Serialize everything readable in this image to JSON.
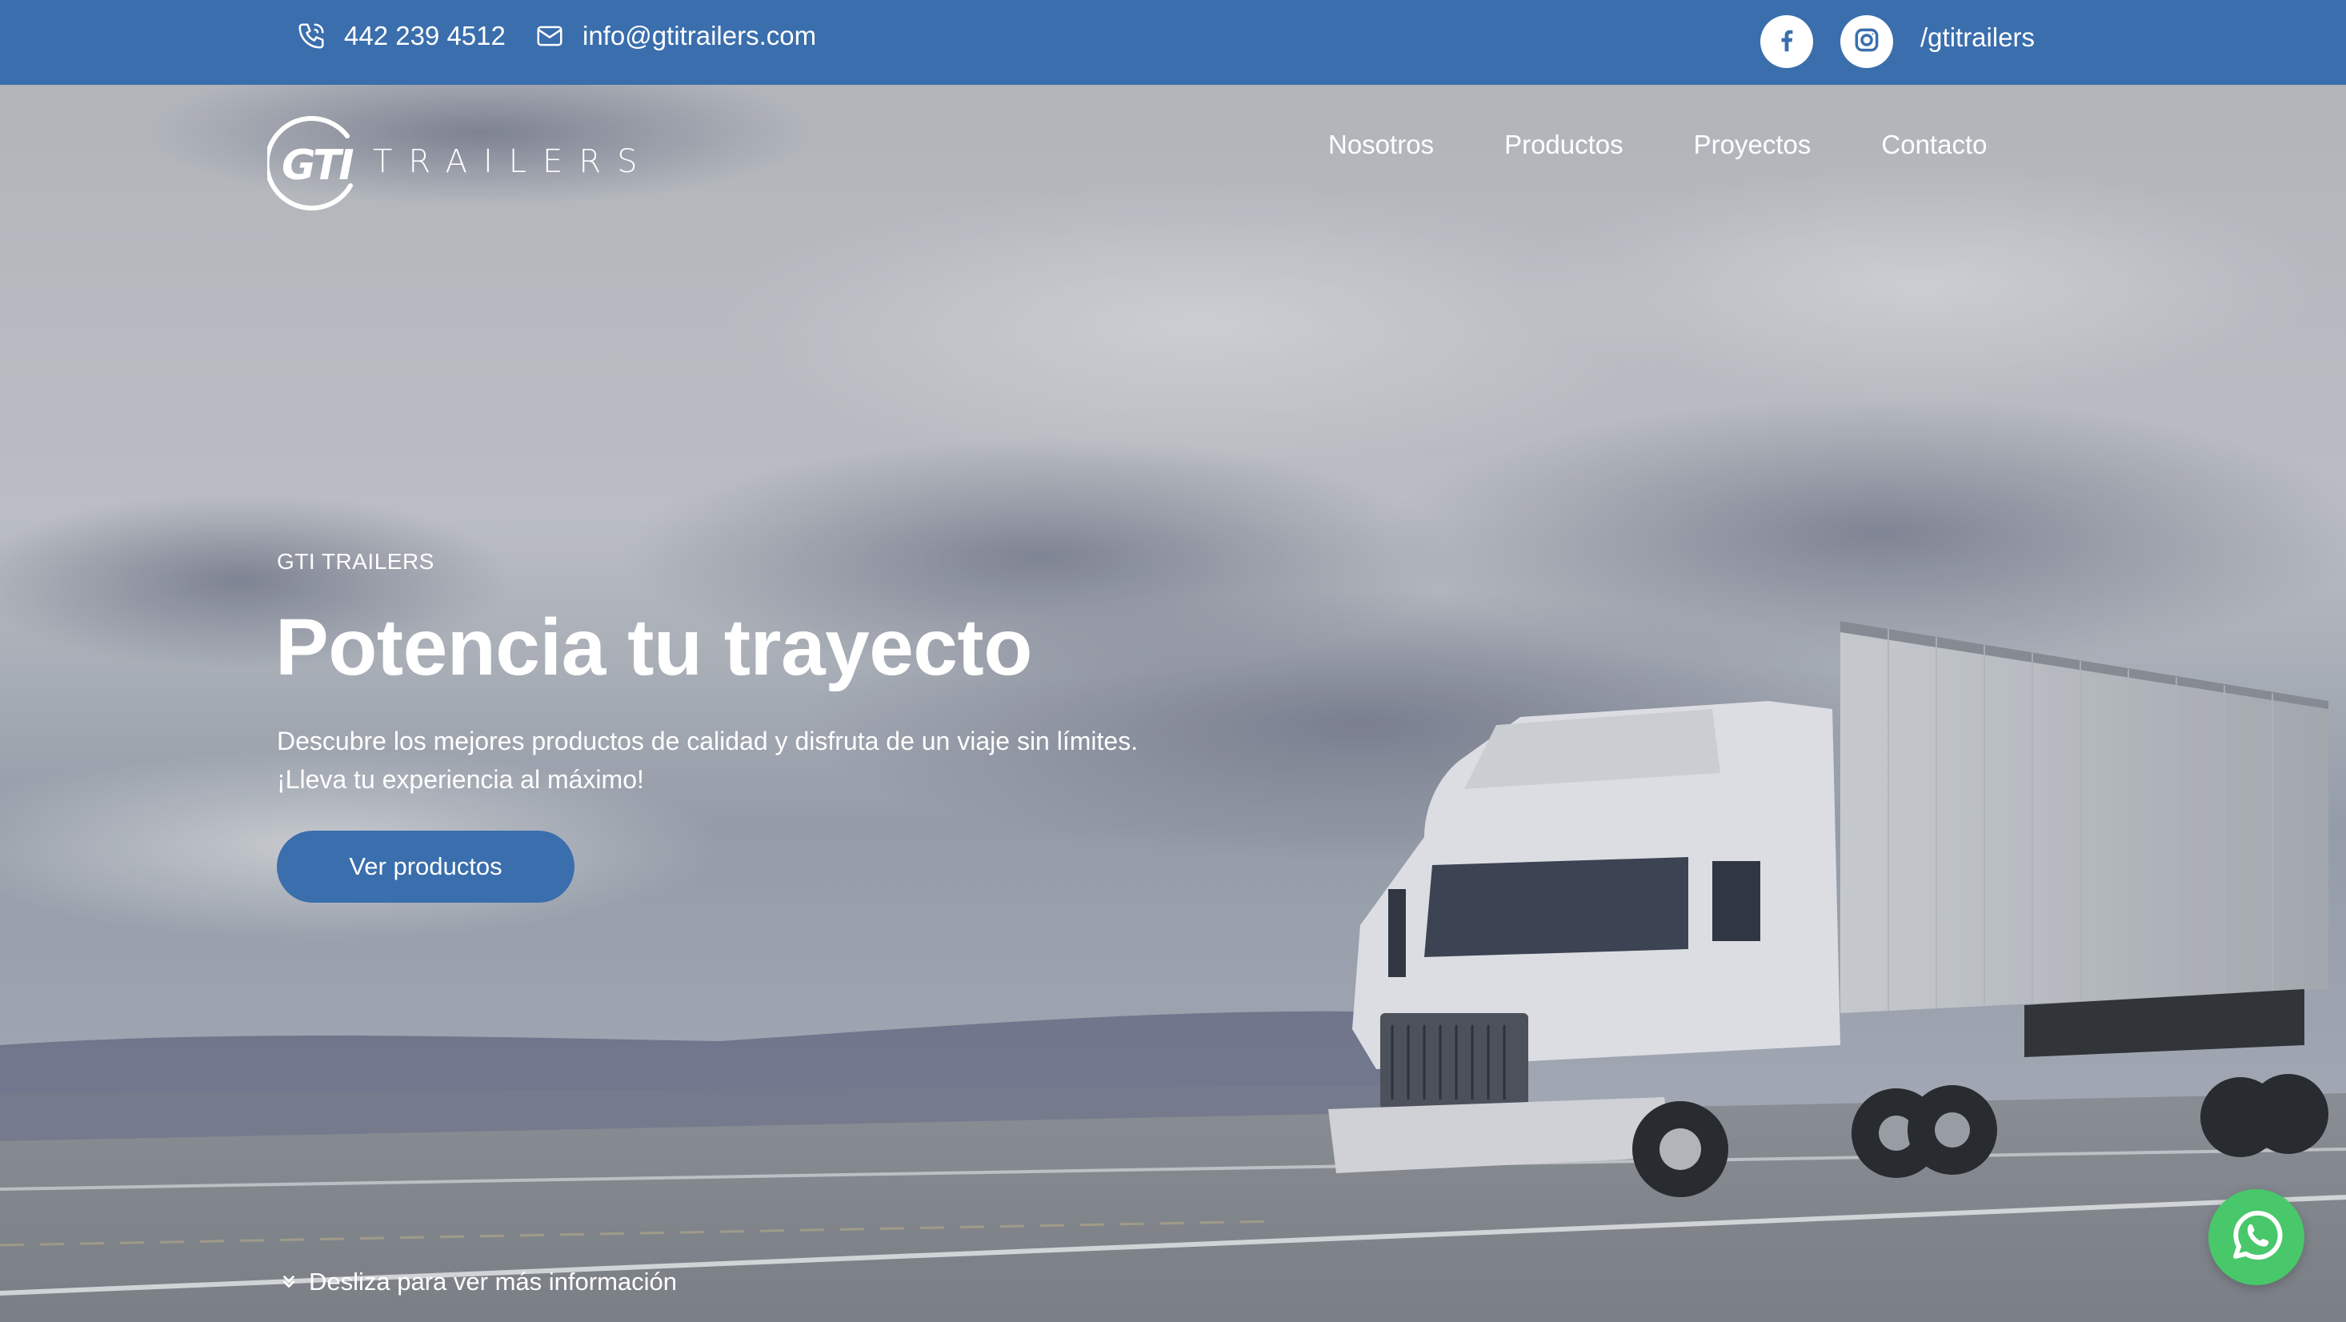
{
  "topbar": {
    "phone": "442 239 4512",
    "email": "info@gtitrailers.com",
    "social_handle": "/gtitrailers",
    "icons": [
      "phone-icon",
      "mail-icon",
      "facebook-icon",
      "instagram-icon"
    ]
  },
  "header": {
    "logo_mark": "GTI",
    "logo_word": "TRAILERS",
    "nav": [
      "Nosotros",
      "Productos",
      "Proyectos",
      "Contacto"
    ]
  },
  "hero": {
    "eyebrow": "GTI TRAILERS",
    "headline": "Potencia tu trayecto",
    "subtext_line1": "Descubre los mejores productos de calidad y disfruta de un viaje sin límites.",
    "subtext_line2": "¡Lleva tu experiencia al máximo!",
    "cta_label": "Ver productos",
    "scroll_hint": "Desliza para ver más información"
  },
  "colors": {
    "brand_blue": "#3a6ead",
    "whatsapp_green": "#49c76b",
    "text": "#ffffff"
  }
}
